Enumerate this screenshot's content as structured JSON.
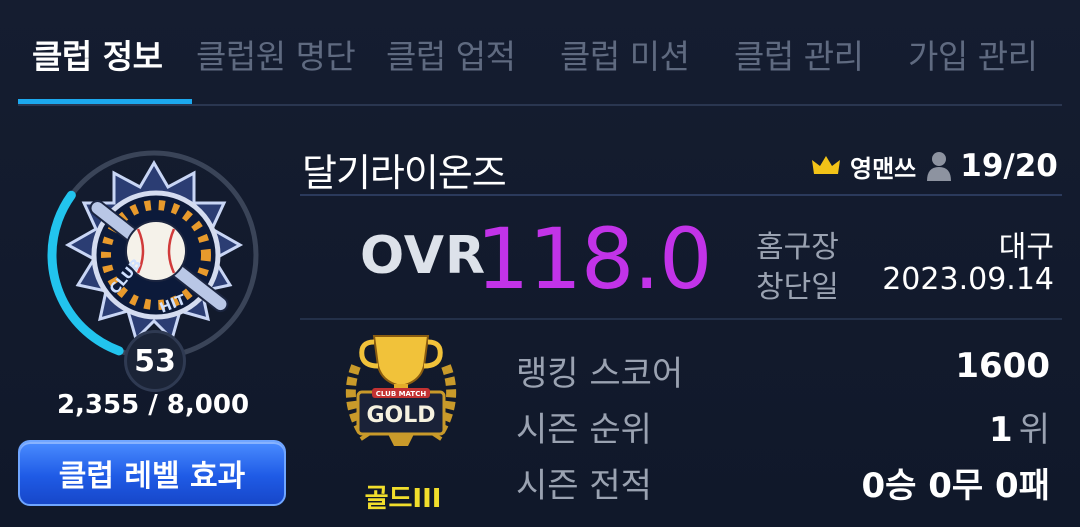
{
  "tabs": [
    {
      "label": "클럽 정보",
      "active": true
    },
    {
      "label": "클럽원 명단",
      "active": false
    },
    {
      "label": "클럽 업적",
      "active": false
    },
    {
      "label": "클럽 미션",
      "active": false
    },
    {
      "label": "클럽 관리",
      "active": false
    },
    {
      "label": "가입 관리",
      "active": false
    }
  ],
  "club": {
    "name": "달기라이온즈",
    "leader": "영맨쓰",
    "members": "19/20",
    "level": "53",
    "exp": "2,355 / 8,000",
    "exp_fraction": 0.294,
    "emblem_text_top": "CLUB",
    "emblem_text_bottom": "HIT"
  },
  "ovr": {
    "label": "OVR",
    "value": "118.0"
  },
  "info": {
    "home_label": "홈구장",
    "home_value": "대구",
    "founded_label": "창단일",
    "founded_value": "2023.09.14"
  },
  "tier": {
    "name": "골드III",
    "emblem_text": "GOLD",
    "emblem_subtext": "CLUB MATCH"
  },
  "stats": {
    "ranking_label": "랭킹 스코어",
    "ranking_value": "1600",
    "rank_label": "시즌 순위",
    "rank_value": "1",
    "rank_unit": "위",
    "record_label": "시즌 전적",
    "record_value": "0승 0무 0패"
  },
  "level_button": "클럽 레벨 효과",
  "colors": {
    "accent": "#1ca8ee",
    "ovr": "#c233e8",
    "tier": "#f1de2c",
    "background": "#111a2c"
  }
}
